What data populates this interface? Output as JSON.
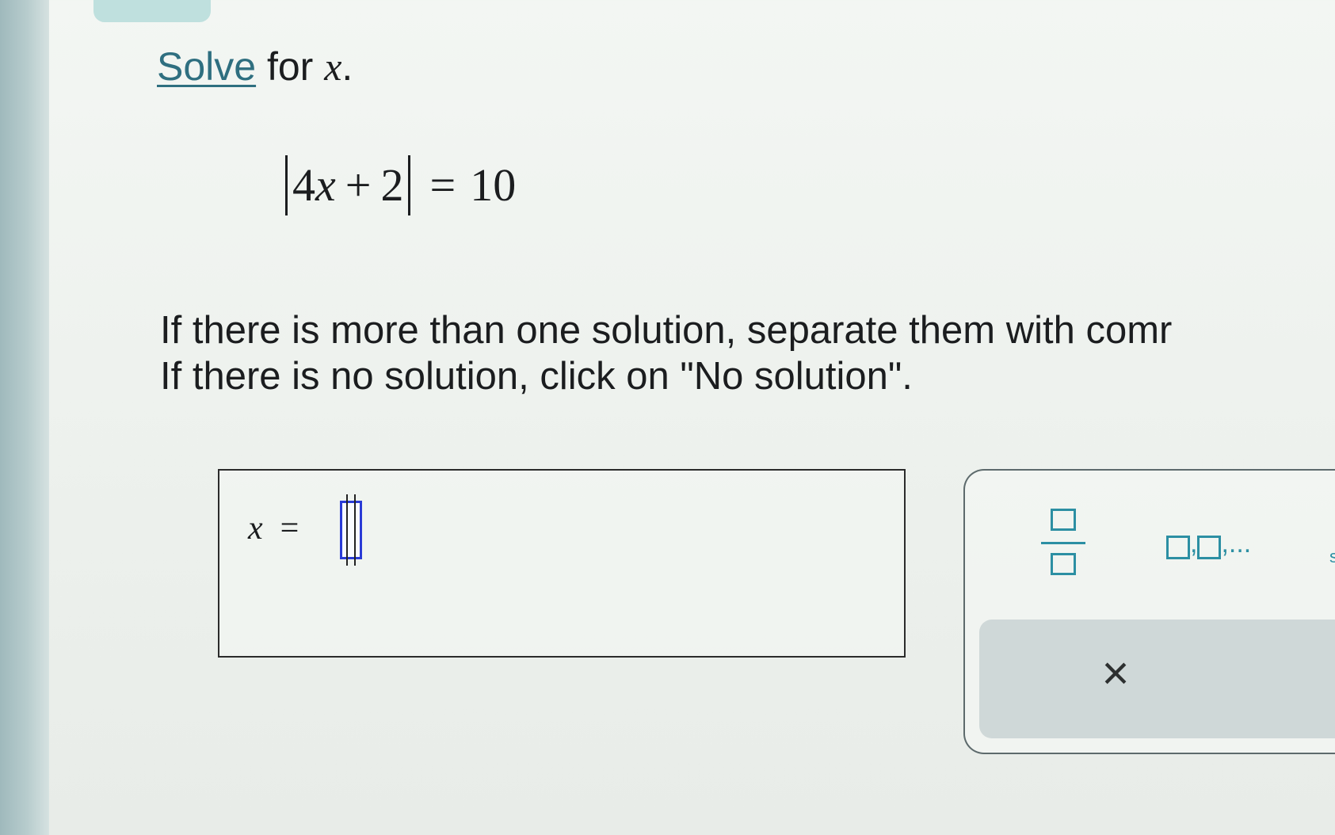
{
  "question": {
    "solve_label": "Solve",
    "for_text": " for ",
    "variable": "x",
    "period": "."
  },
  "equation": {
    "inside": [
      "4",
      "x",
      "+",
      "2"
    ],
    "equals": "=",
    "rhs": "10"
  },
  "instructions": {
    "line1": "If there is more than one solution, separate them with comr",
    "line2": "If there is no solution, click on \"No solution\"."
  },
  "answer": {
    "variable": "x",
    "equals": "=",
    "value": ""
  },
  "toolbox": {
    "list_separator": ",",
    "list_ellipsis": ",...",
    "cut_label": "s",
    "clear_symbol": "×"
  },
  "colors": {
    "accent": "#2c8fa3",
    "input_border": "#2a3bd6",
    "link": "#2f6f80"
  }
}
